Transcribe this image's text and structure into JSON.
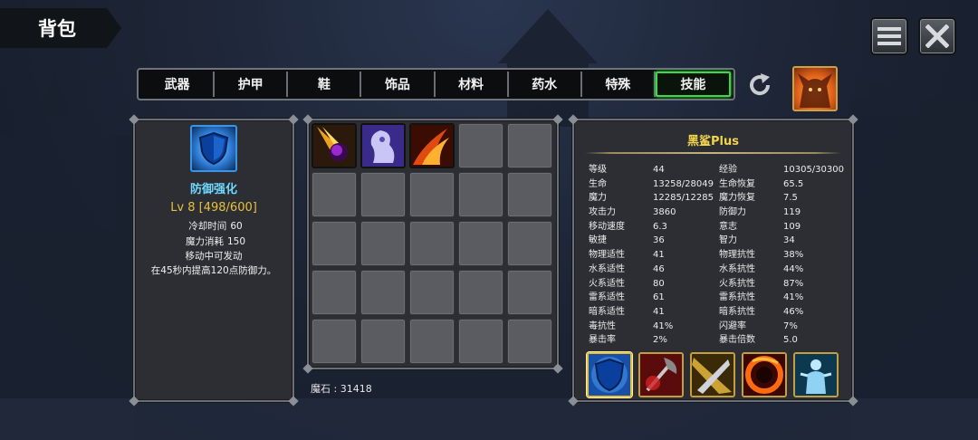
{
  "header": {
    "title": "背包"
  },
  "tabs": [
    {
      "label": "武器"
    },
    {
      "label": "护甲"
    },
    {
      "label": "鞋"
    },
    {
      "label": "饰品"
    },
    {
      "label": "材料"
    },
    {
      "label": "药水"
    },
    {
      "label": "特殊"
    },
    {
      "label": "技能",
      "active": true
    }
  ],
  "skill_detail": {
    "name": "防御强化",
    "level": "Lv 8 [498/600]",
    "cooldown_label": "冷却时间",
    "cooldown_value": "60",
    "mana_label": "魔力消耗",
    "mana_value": "150",
    "note": "移动中可发动",
    "description": "在45秒内提高120点防御力。"
  },
  "inventory": {
    "items": [
      "meteor-skill-icon",
      "ghost-skill-icon",
      "flame-slash-skill-icon"
    ],
    "mana_stone": "魔石 : 31418"
  },
  "character": {
    "name": "黑鲨Plus",
    "stats": [
      [
        "等级",
        "44",
        "经验",
        "10305/30300"
      ],
      [
        "生命",
        "13258/28049",
        "生命恢复",
        "65.5"
      ],
      [
        "魔力",
        "12285/12285",
        "魔力恢复",
        "7.5"
      ],
      [
        "攻击力",
        "3860",
        "防御力",
        "119"
      ],
      [
        "移动速度",
        "6.3",
        "意志",
        "109"
      ],
      [
        "敏捷",
        "36",
        "智力",
        "34"
      ],
      [
        "物理适性",
        "41",
        "物理抗性",
        "38%"
      ],
      [
        "水系适性",
        "46",
        "水系抗性",
        "44%"
      ],
      [
        "火系适性",
        "80",
        "火系抗性",
        "87%"
      ],
      [
        "雷系适性",
        "61",
        "雷系抗性",
        "41%"
      ],
      [
        "暗系适性",
        "41",
        "暗系抗性",
        "46%"
      ],
      [
        "毒抗性",
        "41%",
        "闪避率",
        "7%"
      ],
      [
        "暴击率",
        "2%",
        "暴击倍数",
        "5.0"
      ]
    ],
    "equipped_skills": [
      "shield-skill-icon",
      "axe-strike-skill-icon",
      "blade-slash-skill-icon",
      "fire-vortex-skill-icon",
      "spirit-skill-icon"
    ]
  },
  "colors": {
    "active_tab": "#44d44a",
    "skill_name": "#6fd8ff",
    "skill_level": "#e6c33a",
    "char_name": "#f0d44a"
  }
}
